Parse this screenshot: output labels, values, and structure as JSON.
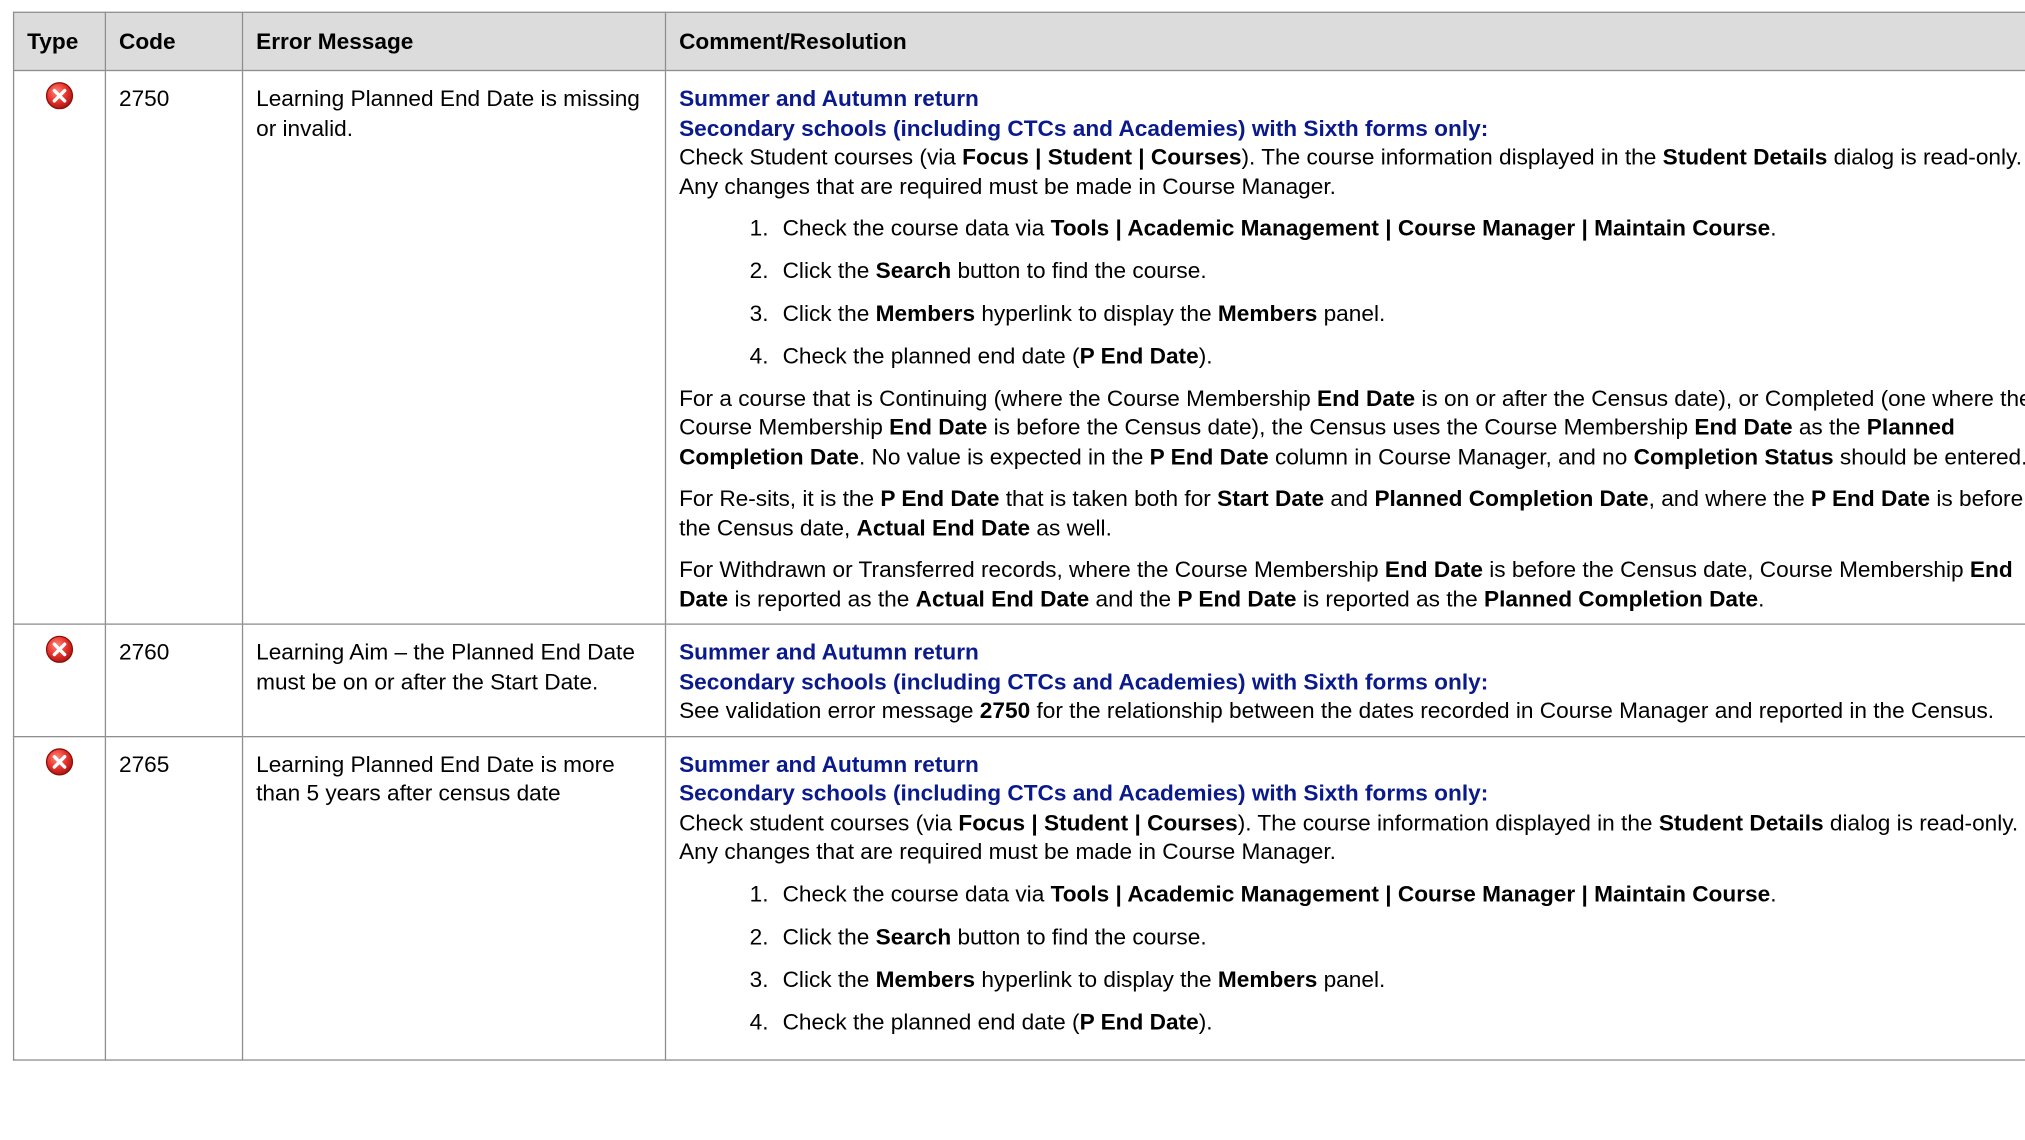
{
  "header": {
    "type": "Type",
    "code": "Code",
    "error_message": "Error Message",
    "comment": "Comment/Resolution"
  },
  "icons": {
    "error": "error-x-icon",
    "error_color": "#e8322c"
  },
  "rows": [
    {
      "code": "2750",
      "message": "Learning Planned End Date is missing or invalid.",
      "heading1": "Summer and Autumn return",
      "heading2": "Secondary schools (including CTCs and Academies) with Sixth forms only:",
      "intro": [
        {
          "t": "Check Student courses (via "
        },
        {
          "t": "Focus | Student | Courses",
          "b": true
        },
        {
          "t": "). The course information displayed in the "
        },
        {
          "t": "Student Details",
          "b": true
        },
        {
          "t": " dialog is read-only. Any changes that are required must be made in Course Manager."
        }
      ],
      "steps": [
        [
          {
            "t": "Check the course data via "
          },
          {
            "t": "Tools | Academic Management | Course Manager | Maintain Course",
            "b": true
          },
          {
            "t": "."
          }
        ],
        [
          {
            "t": "Click the "
          },
          {
            "t": "Search",
            "b": true
          },
          {
            "t": " button to find the course."
          }
        ],
        [
          {
            "t": "Click the "
          },
          {
            "t": "Members",
            "b": true
          },
          {
            "t": " hyperlink to display the "
          },
          {
            "t": "Members",
            "b": true
          },
          {
            "t": " panel."
          }
        ],
        [
          {
            "t": "Check the planned end date ("
          },
          {
            "t": "P End Date",
            "b": true
          },
          {
            "t": ")."
          }
        ]
      ],
      "paragraphs": [
        [
          {
            "t": "For a course that is Continuing (where the Course Membership "
          },
          {
            "t": "End Date",
            "b": true
          },
          {
            "t": " is on or after the Census date), or Completed (one where the Course Membership "
          },
          {
            "t": "End Date",
            "b": true
          },
          {
            "t": " is before the Census date), the Census uses the Course Membership "
          },
          {
            "t": "End Date",
            "b": true
          },
          {
            "t": " as the "
          },
          {
            "t": "Planned Completion Date",
            "b": true
          },
          {
            "t": ". No value is expected in the "
          },
          {
            "t": "P End Date",
            "b": true
          },
          {
            "t": " column in Course Manager, and no "
          },
          {
            "t": "Completion Status",
            "b": true
          },
          {
            "t": " should be entered."
          }
        ],
        [
          {
            "t": "For Re-sits, it is the "
          },
          {
            "t": "P End Date",
            "b": true
          },
          {
            "t": " that is taken both for "
          },
          {
            "t": "Start Date",
            "b": true
          },
          {
            "t": " and "
          },
          {
            "t": "Planned Completion Date",
            "b": true
          },
          {
            "t": ", and where the "
          },
          {
            "t": "P End Date",
            "b": true
          },
          {
            "t": " is before the Census date, "
          },
          {
            "t": "Actual End Date",
            "b": true
          },
          {
            "t": " as well."
          }
        ],
        [
          {
            "t": "For Withdrawn or Transferred records, where the Course Membership "
          },
          {
            "t": "End Date",
            "b": true
          },
          {
            "t": " is before the Census date, Course Membership "
          },
          {
            "t": "End Date",
            "b": true
          },
          {
            "t": " is reported as the "
          },
          {
            "t": "Actual End Date",
            "b": true
          },
          {
            "t": " and the "
          },
          {
            "t": "P End Date",
            "b": true
          },
          {
            "t": " is reported as the "
          },
          {
            "t": "Planned Completion Date",
            "b": true
          },
          {
            "t": "."
          }
        ]
      ]
    },
    {
      "code": "2760",
      "message": "Learning Aim – the Planned End Date must be on or after the Start Date.",
      "heading1": "Summer and Autumn return",
      "heading2": "Secondary schools (including CTCs and Academies) with Sixth forms only:",
      "intro": [
        {
          "t": "See validation error message "
        },
        {
          "t": "2750",
          "b": true
        },
        {
          "t": " for the relationship between the dates recorded in Course Manager and reported in the Census."
        }
      ],
      "steps": [],
      "paragraphs": []
    },
    {
      "code": "2765",
      "message": "Learning Planned End Date is more than 5 years after census date",
      "heading1": "Summer and Autumn return",
      "heading2": "Secondary schools (including CTCs and Academies) with Sixth forms only:",
      "intro": [
        {
          "t": "Check student courses (via "
        },
        {
          "t": "Focus | Student | Courses",
          "b": true
        },
        {
          "t": "). The course information displayed in the "
        },
        {
          "t": "Student Details",
          "b": true
        },
        {
          "t": " dialog is read-only. Any changes that are required must be made in Course Manager."
        }
      ],
      "steps": [
        [
          {
            "t": "Check the course data via "
          },
          {
            "t": "Tools | Academic Management | Course Manager | Maintain Course",
            "b": true
          },
          {
            "t": "."
          }
        ],
        [
          {
            "t": "Click the "
          },
          {
            "t": "Search",
            "b": true
          },
          {
            "t": " button to find the course."
          }
        ],
        [
          {
            "t": "Click the "
          },
          {
            "t": "Members",
            "b": true
          },
          {
            "t": " hyperlink to display the "
          },
          {
            "t": "Members",
            "b": true
          },
          {
            "t": " panel."
          }
        ],
        [
          {
            "t": "Check the planned end date ("
          },
          {
            "t": "P End Date",
            "b": true
          },
          {
            "t": ")."
          }
        ]
      ],
      "paragraphs": []
    }
  ]
}
